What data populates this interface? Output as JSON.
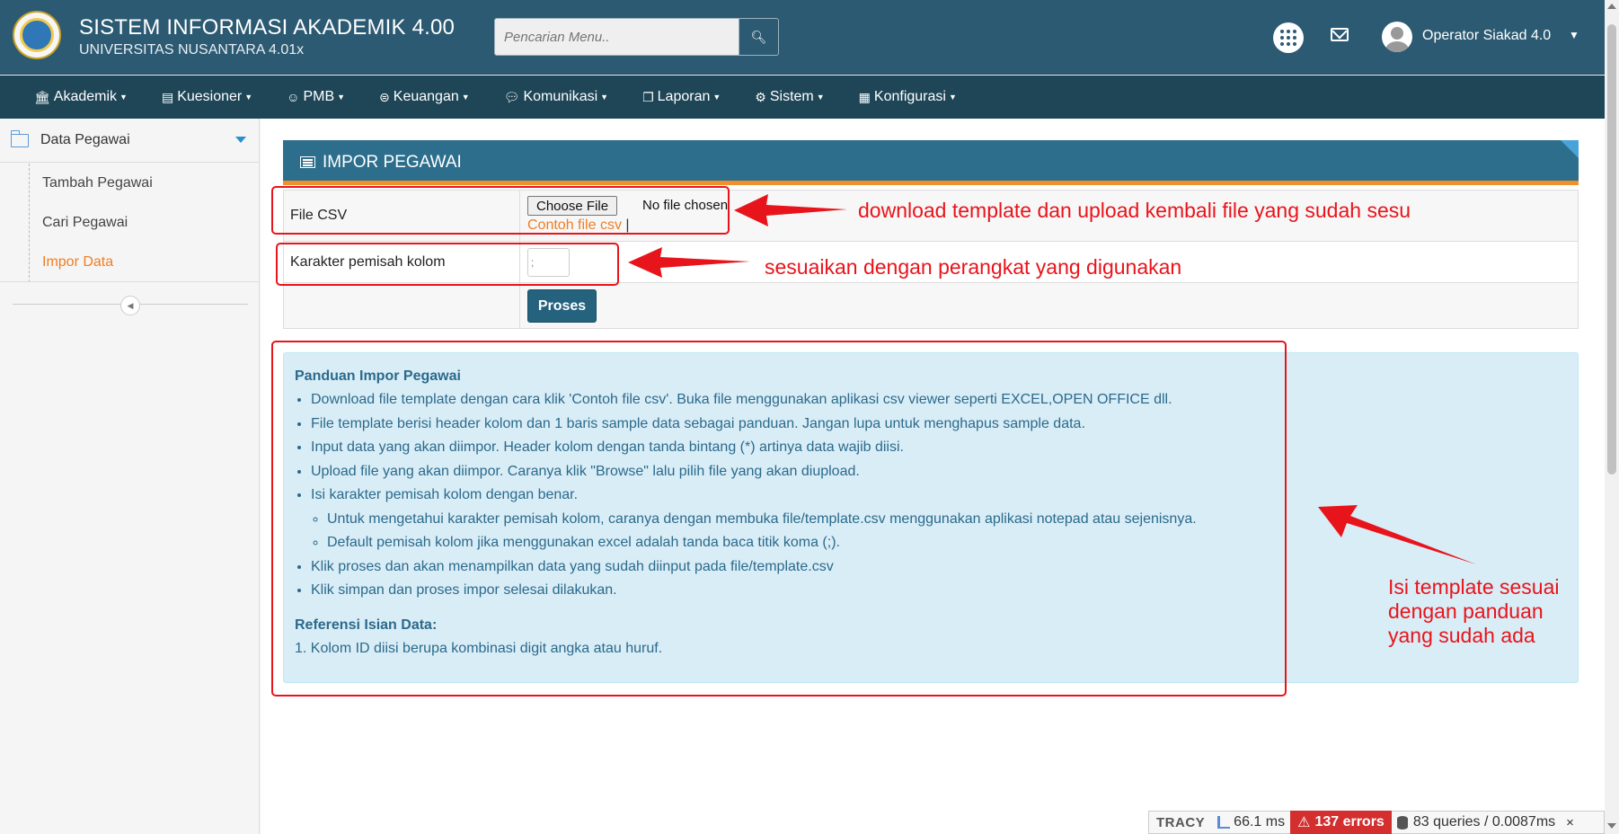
{
  "header": {
    "title": "SISTEM INFORMASI AKADEMIK 4.00",
    "subtitle": "UNIVERSITAS NUSANTARA 4.01x",
    "search_placeholder": "Pencarian Menu..",
    "user_name": "Operator Siakad 4.0",
    "icons": {
      "search": "search-icon",
      "apps": "apps-grid-icon",
      "mail": "mail-icon",
      "avatar": "user-avatar"
    }
  },
  "menubar": {
    "items": [
      {
        "label": "Akademik",
        "icon": "bank-icon"
      },
      {
        "label": "Kuesioner",
        "icon": "clipboard-icon"
      },
      {
        "label": "PMB",
        "icon": "user-icon"
      },
      {
        "label": "Keuangan",
        "icon": "money-icon"
      },
      {
        "label": "Komunikasi",
        "icon": "chat-icon"
      },
      {
        "label": "Laporan",
        "icon": "copy-icon"
      },
      {
        "label": "Sistem",
        "icon": "gear-icon"
      },
      {
        "label": "Konfigurasi",
        "icon": "grid-icon"
      }
    ]
  },
  "sidebar": {
    "title": "Data Pegawai",
    "items": [
      {
        "label": "Tambah Pegawai"
      },
      {
        "label": "Cari Pegawai"
      },
      {
        "label": "Impor Data",
        "active": true
      }
    ]
  },
  "panel": {
    "title": "IMPOR PEGAWAI",
    "file_label": "File CSV",
    "choose_file": "Choose File",
    "no_file": "No file chosen",
    "sample_link": "Contoh file csv",
    "sample_sep": "|",
    "separator_label": "Karakter pemisah kolom",
    "separator_value": ";",
    "process_button": "Proses"
  },
  "guide": {
    "title": "Panduan Impor Pegawai",
    "items": [
      "Download file template dengan cara klik 'Contoh file csv'. Buka file menggunakan aplikasi csv viewer seperti EXCEL,OPEN OFFICE dll.",
      "File template berisi header kolom dan 1 baris sample data sebagai panduan. Jangan lupa untuk menghapus sample data.",
      "Input data yang akan diimpor. Header kolom dengan tanda bintang (*) artinya data wajib diisi.",
      "Upload file yang akan diimpor. Caranya klik \"Browse\" lalu pilih file yang akan diupload.",
      "Isi karakter pemisah kolom dengan benar.",
      "Klik proses dan akan menampilkan data yang sudah diinput pada file/template.csv",
      "Klik simpan dan proses impor selesai dilakukan."
    ],
    "subitems": [
      "Untuk mengetahui karakter pemisah kolom, caranya dengan membuka file/template.csv menggunakan aplikasi notepad atau sejenisnya.",
      "Default pemisah kolom jika menggunakan excel adalah tanda baca titik koma (;)."
    ],
    "ref_title": "Referensi Isian Data:",
    "ref_items": [
      "1. Kolom ID diisi berupa kombinasi digit angka atau huruf."
    ]
  },
  "annotations": {
    "note1": "download template dan upload kembali file yang sudah sesu",
    "note2": "sesuaikan dengan perangkat yang digunakan",
    "note3_line1": "Isi template sesuai",
    "note3_line2": "dengan panduan",
    "note3_line3": "yang sudah ada",
    "color": "#e8141b"
  },
  "tracy": {
    "logo": "TRACY",
    "time": "66.1 ms",
    "errors": "137 errors",
    "queries": "83 queries / 0.0087ms",
    "close": "×"
  },
  "colors": {
    "header_bg": "#2b5a72",
    "menubar_bg": "#1e4657",
    "panel_head": "#2d6e8c",
    "accent_orange": "#f07d23",
    "guide_bg": "#d9edf7"
  }
}
